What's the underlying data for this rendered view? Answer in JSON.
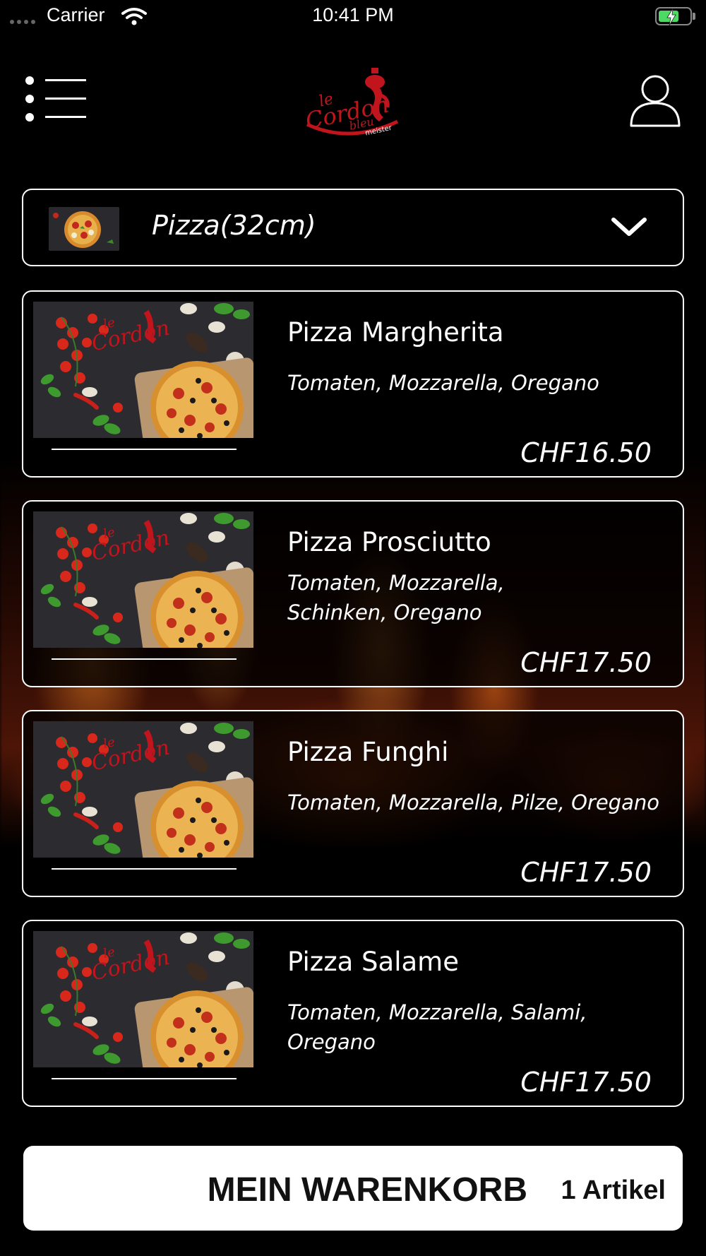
{
  "status_bar": {
    "carrier": "Carrier",
    "time": "10:41 PM"
  },
  "header": {
    "logo_text": [
      "le",
      "Cordon",
      "bleu",
      "meister"
    ],
    "brand_color": "#c0151d"
  },
  "category": {
    "label": "Pizza(32cm)"
  },
  "items": [
    {
      "name": "Pizza Margherita",
      "desc_lines": [
        "Tomaten, Mozzarella, Oregano"
      ],
      "price": "CHF16.50"
    },
    {
      "name": "Pizza Prosciutto",
      "desc_lines": [
        "Tomaten, Mozzarella,",
        "Schinken, Oregano"
      ],
      "price": "CHF17.50"
    },
    {
      "name": "Pizza Funghi",
      "desc_lines": [
        "Tomaten, Mozzarella, Pilze, Oregano"
      ],
      "price": "CHF17.50"
    },
    {
      "name": "Pizza Salame",
      "desc_lines": [
        "Tomaten, Mozzarella, Salami, Oregano"
      ],
      "price": "CHF17.50"
    }
  ],
  "cart": {
    "title": "MEIN WARENKORB",
    "count": "1 Artikel"
  },
  "icons": {
    "menu": "hamburger-menu-icon",
    "profile": "user-profile-icon",
    "dropdown": "chevron-down-icon",
    "wifi": "wifi-icon",
    "battery": "battery-charging-icon"
  },
  "colors": {
    "background": "#000000",
    "accent": "#c0151d",
    "battery_fill": "#4cd964"
  }
}
